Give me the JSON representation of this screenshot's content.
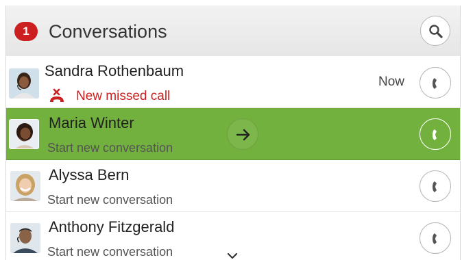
{
  "header": {
    "badge_count": "1",
    "title": "Conversations",
    "search_icon": "search-icon"
  },
  "conversations": [
    {
      "name": "Sandra Rothenbaum",
      "status": "missed",
      "missed_text": "New missed call",
      "time": "Now",
      "selected": false
    },
    {
      "name": "Maria Winter",
      "subtitle": "Start new conversation",
      "selected": true
    },
    {
      "name": "Alyssa Bern",
      "subtitle": "Start new conversation",
      "selected": false
    },
    {
      "name": "Anthony Fitzgerald",
      "subtitle": "Start new conversation",
      "selected": false
    }
  ],
  "colors": {
    "accent_green": "#72b13d",
    "badge_red": "#cc1f1f",
    "missed_red": "#cc1f1f"
  }
}
